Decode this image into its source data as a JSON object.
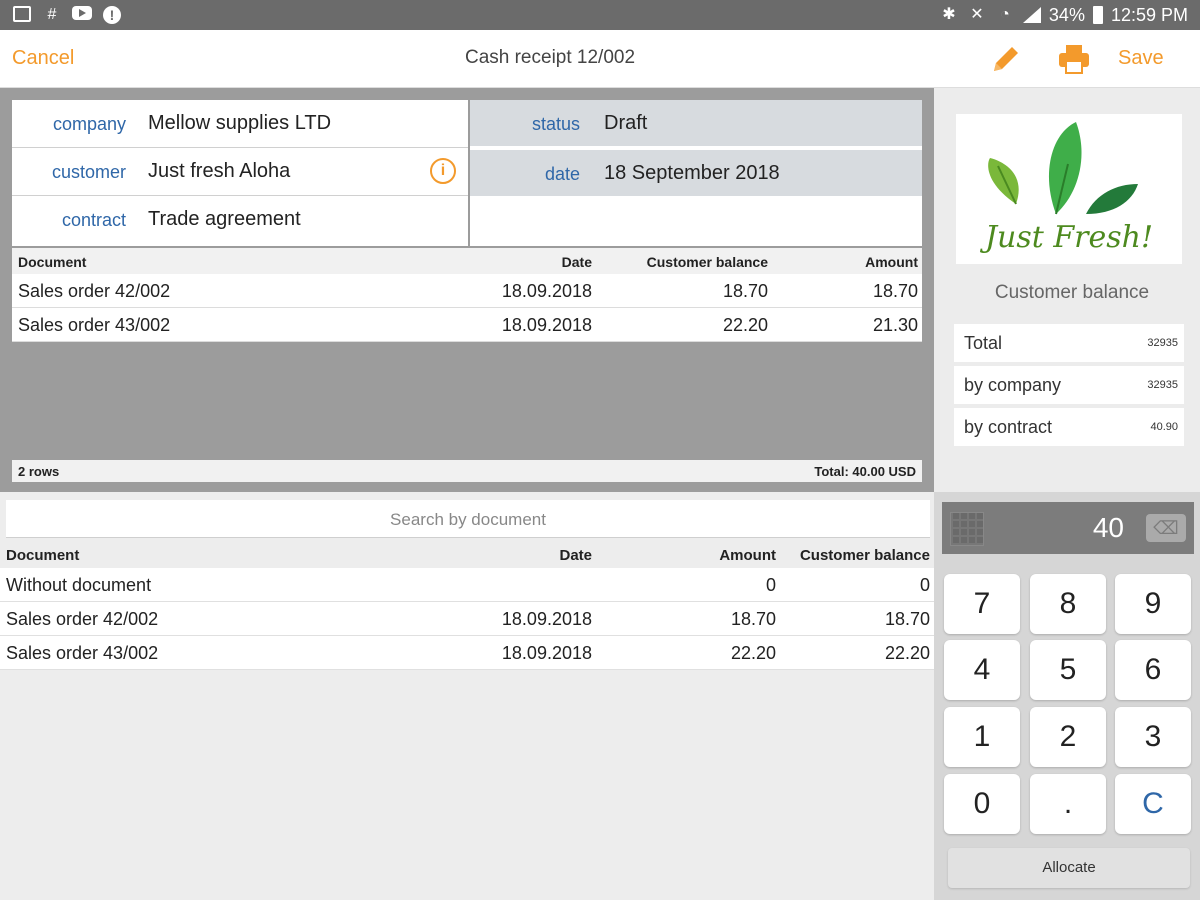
{
  "statusbar": {
    "icons_left": [
      "gallery-icon",
      "hash-icon",
      "youtube-icon",
      "alert-icon"
    ],
    "icons_right": [
      "bluetooth-icon",
      "mute-icon",
      "wifi-icon",
      "signal-icon"
    ],
    "battery": "34%",
    "time": "12:59 PM"
  },
  "topbar": {
    "cancel_label": "Cancel",
    "title": "Cash receipt 12/002",
    "save_label": "Save",
    "accent_color": "#f39a2c"
  },
  "header": {
    "company_label": "company",
    "company_value": "Mellow supplies LTD",
    "customer_label": "customer",
    "customer_value": "Just fresh Aloha",
    "contract_label": "contract",
    "contract_value": "Trade agreement",
    "status_label": "status",
    "status_value": "Draft",
    "date_label": "date",
    "date_value": "18 September 2018"
  },
  "documents_table": {
    "columns": [
      "Document",
      "Date",
      "Customer balance",
      "Amount"
    ],
    "rows": [
      [
        "Sales order 42/002",
        "18.09.2018",
        "18.70",
        "18.70"
      ],
      [
        "Sales order 43/002",
        "18.09.2018",
        "22.20",
        "21.30"
      ]
    ],
    "rows_count": "2 rows",
    "total": "Total: 40.00 USD"
  },
  "search": {
    "placeholder": "Search by document"
  },
  "available_table": {
    "columns": [
      "Document",
      "Date",
      "Amount",
      "Customer balance"
    ],
    "rows": [
      [
        "Without document",
        "",
        "0",
        "0"
      ],
      [
        "Sales order 42/002",
        "18.09.2018",
        "18.70",
        "18.70"
      ],
      [
        "Sales order 43/002",
        "18.09.2018",
        "22.20",
        "22.20"
      ]
    ]
  },
  "side": {
    "logo_text": "Just Fresh!",
    "balance_title": "Customer balance",
    "balances": [
      {
        "label": "Total",
        "value": "32935"
      },
      {
        "label": "by company",
        "value": "32935"
      },
      {
        "label": "by contract",
        "value": "40.90"
      }
    ]
  },
  "keypad": {
    "display_value": "40",
    "keys": [
      "7",
      "8",
      "9",
      "4",
      "5",
      "6",
      "1",
      "2",
      "3",
      "0",
      ".",
      "C"
    ],
    "allocate_label": "Allocate"
  }
}
